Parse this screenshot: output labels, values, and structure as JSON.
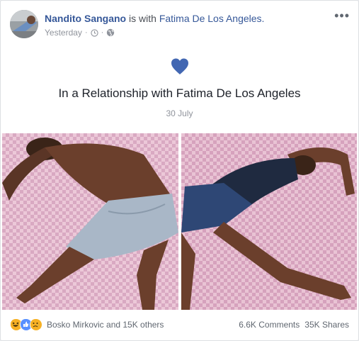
{
  "post": {
    "author": "Nandito Sangano",
    "with_text": "is with",
    "tagged": "Fatima De Los Angeles.",
    "timestamp": "Yesterday",
    "privacy_separator": "·",
    "more_label": "•••"
  },
  "life_event": {
    "icon": "heart-icon",
    "title": "In a Relationship with Fatima De Los Angeles",
    "date": "30 July",
    "heart_color": "#4267b2"
  },
  "photos": [
    {
      "semantic": "photo-boy-on-pink-checkered-bed"
    },
    {
      "semantic": "photo-girl-on-pink-checkered-bed"
    }
  ],
  "footer": {
    "reactions": [
      "haha-icon",
      "like-icon",
      "sad-icon"
    ],
    "reaction_names": "Bosko Mirkovic and 15K others",
    "comments": "6.6K Comments",
    "shares": "35K Shares"
  },
  "colors": {
    "link_blue": "#365899",
    "secondary_text": "#90949c",
    "bed_pink": "#d6a3bd",
    "bed_pink_alt": "#e4bfd0"
  }
}
